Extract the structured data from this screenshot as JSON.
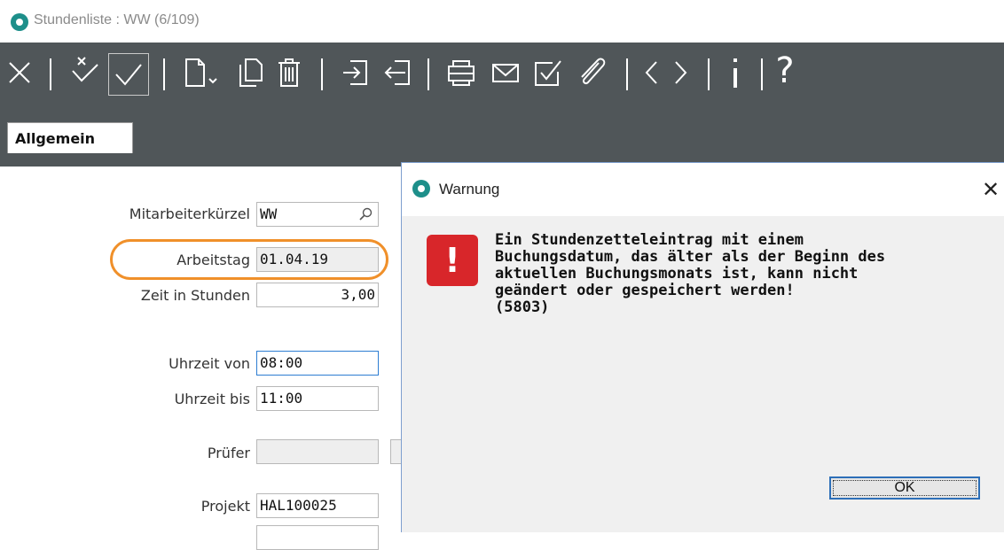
{
  "window": {
    "title": "Stundenliste : WW (6/109)"
  },
  "tabs": [
    {
      "label": "Allgemein"
    }
  ],
  "toolbar": {
    "icons": [
      "close-icon",
      "discard-changes-icon",
      "save-icon",
      "new-document-icon",
      "copy-icon",
      "delete-icon",
      "import-icon",
      "export-icon",
      "print-icon",
      "mail-icon",
      "checkbox-icon",
      "attachment-icon",
      "previous-icon",
      "next-icon",
      "info-icon",
      "help-icon"
    ],
    "help_glyph": "?"
  },
  "form": {
    "mitarbeiter": {
      "label": "Mitarbeiterkürzel",
      "value": "WW"
    },
    "arbeitstag": {
      "label": "Arbeitstag",
      "value": "01.04.19"
    },
    "zeit": {
      "label": "Zeit in Stunden",
      "value": "3,00"
    },
    "uhrzeit_von": {
      "label": "Uhrzeit von",
      "value": "08:00"
    },
    "uhrzeit_bis": {
      "label": "Uhrzeit bis",
      "value": "11:00"
    },
    "pruefer": {
      "label": "Prüfer",
      "value": ""
    },
    "projekt": {
      "label": "Projekt",
      "value": "HAL100025"
    }
  },
  "dialog": {
    "title": "Warnung",
    "close_glyph": "✕",
    "icon_glyph": "!",
    "message_lines": [
      "Ein Stundenzetteleintrag mit einem",
      "Buchungsdatum, das älter als der Beginn des",
      "aktuellen Buchungsmonats ist, kann nicht",
      "geändert oder gespeichert werden!",
      "(5803)"
    ],
    "ok_label": "OK"
  },
  "colors": {
    "toolbar_bg": "#505659",
    "highlight": "#f0902a",
    "error_red": "#d8262a",
    "brand_teal": "#1d8f8a"
  }
}
